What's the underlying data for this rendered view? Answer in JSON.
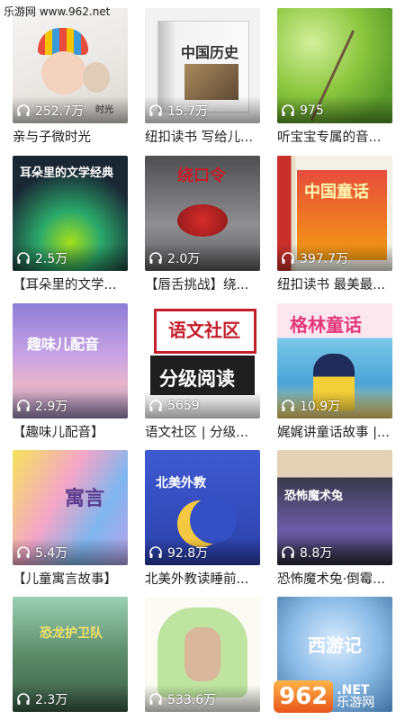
{
  "watermark": {
    "top": "乐游网 www.962.net",
    "logo": "962",
    "net": ".NET",
    "cn": "乐游网"
  },
  "items": [
    {
      "count": "252.7万",
      "title": "亲与子微时光",
      "overlay": "时光"
    },
    {
      "count": "15.7万",
      "title": "纽扣读书 写给儿...",
      "overlay": "中国历史"
    },
    {
      "count": "975",
      "title": "听宝宝专属的音...",
      "overlay": ""
    },
    {
      "count": "2.5万",
      "title": "【耳朵里的文学...",
      "overlay": "耳朵里的文学经典"
    },
    {
      "count": "2.0万",
      "title": "【唇舌挑战】绕...",
      "overlay": "绕口令"
    },
    {
      "count": "397.7万",
      "title": "纽扣读书 最美最...",
      "overlay": "中国童话"
    },
    {
      "count": "2.9万",
      "title": "【趣味儿配音】",
      "overlay": "趣味儿配音"
    },
    {
      "count": "5659",
      "title": "语文社区 | 分级...",
      "overlay": "分级阅读",
      "overlay2": "语文社区"
    },
    {
      "count": "10.9万",
      "title": "娓娓讲童话故事 |...",
      "overlay": "格林童话"
    },
    {
      "count": "5.4万",
      "title": "【儿童寓言故事】",
      "overlay": "寓言"
    },
    {
      "count": "92.8万",
      "title": "北美外教读睡前...",
      "overlay": "北美外教"
    },
    {
      "count": "8.8万",
      "title": "恐怖魔术兔·倒霉...",
      "overlay": "恐怖魔术兔"
    },
    {
      "count": "2.3万",
      "title": "",
      "overlay": "恐龙护卫队"
    },
    {
      "count": "533.6万",
      "title": "",
      "overlay": ""
    },
    {
      "count": "",
      "title": "",
      "overlay": "西游记"
    }
  ],
  "colors": {
    "text": "#222222",
    "accent": "#e8541a"
  }
}
